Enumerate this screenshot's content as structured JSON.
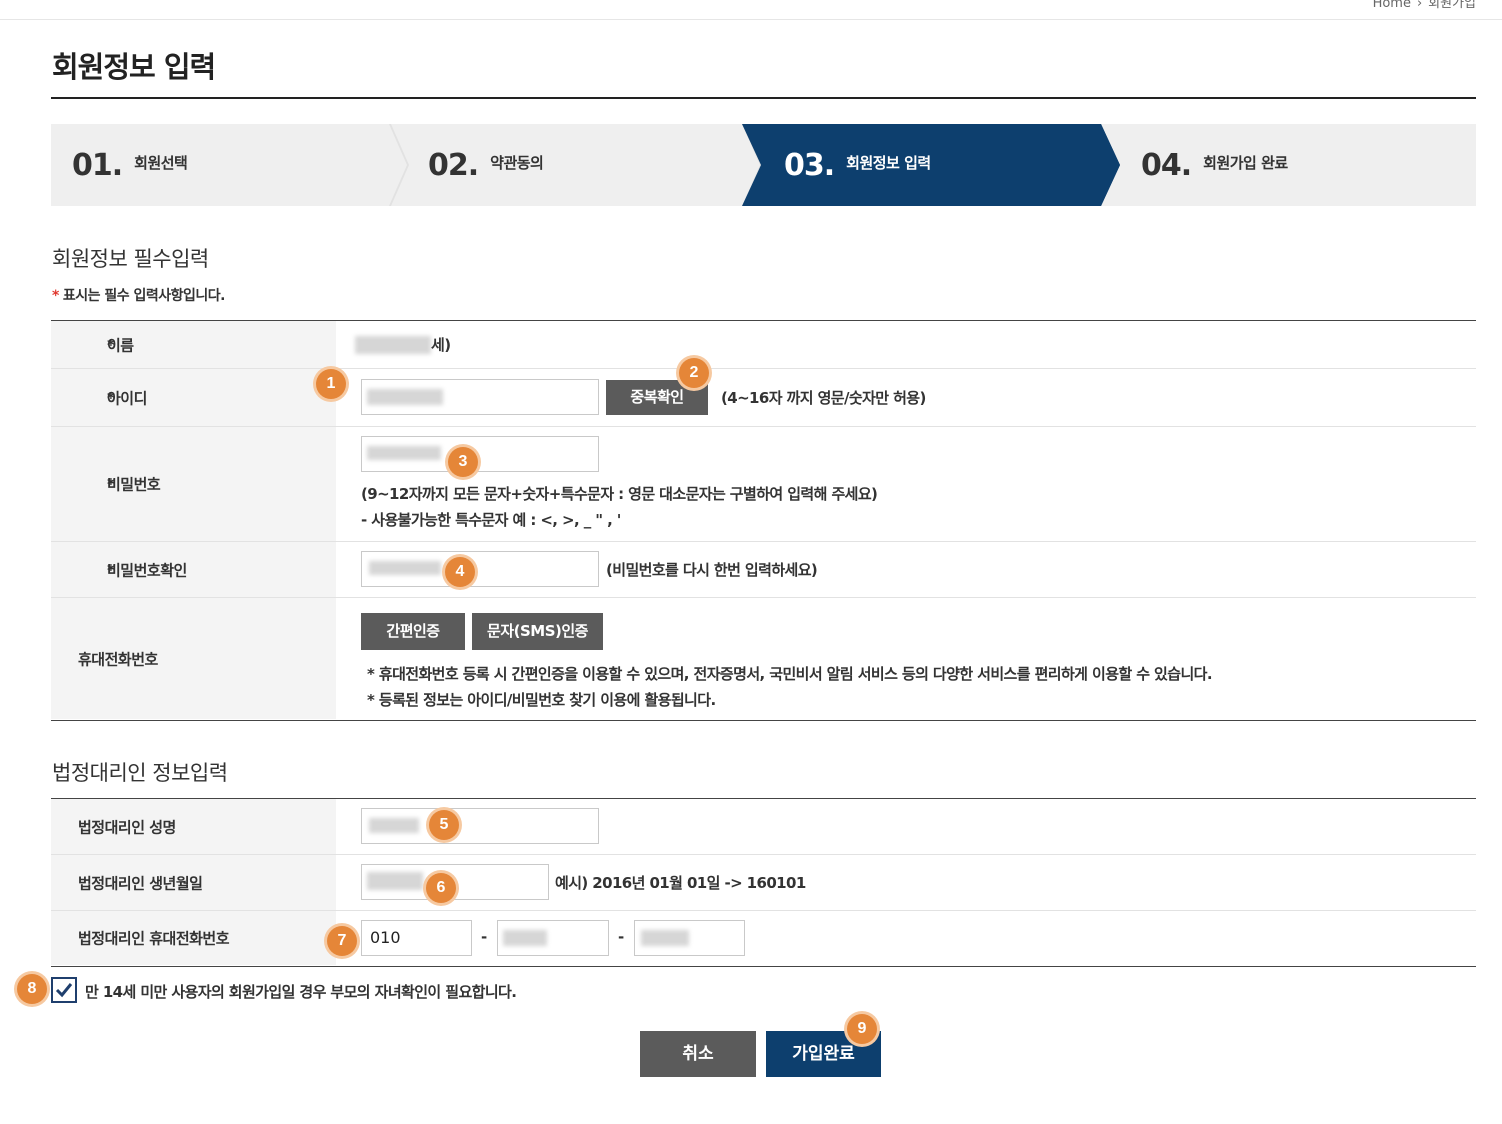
{
  "breadcrumb": {
    "home": "Home",
    "current": "회원가입"
  },
  "page_title": "회원정보 입력",
  "steps": [
    {
      "num": "01.",
      "label": "회원선택",
      "active": false
    },
    {
      "num": "02.",
      "label": "약관동의",
      "active": false
    },
    {
      "num": "03.",
      "label": "회원정보 입력",
      "active": true
    },
    {
      "num": "04.",
      "label": "회원가입 완료",
      "active": false
    }
  ],
  "colors": {
    "accent_navy": "#0d3f6e",
    "badge_orange": "#e58638",
    "required_red": "#e0382f",
    "button_gray": "#5b5b5b"
  },
  "required_section": {
    "title": "회원정보 필수입력",
    "required_note": "표시는 필수 입력사항입니다.",
    "required_mark": "*",
    "name": {
      "label": "이름",
      "value_suffix": "세)"
    },
    "id": {
      "label": "아이디",
      "check_button": "중복확인",
      "hint": "(4~16자 까지 영문/숫자만 허용)"
    },
    "password": {
      "label": "비밀번호",
      "hint1": "(9~12자까지 모든 문자+숫자+특수문자 : 영문 대소문자는 구별하여 입력해 주세요)",
      "hint2": "- 사용불가능한 특수문자 예 : <, >, _ \" , '"
    },
    "password_confirm": {
      "label": "비밀번호확인",
      "hint": "(비밀번호를 다시 한번 입력하세요)"
    },
    "phone": {
      "label": "휴대전화번호",
      "easy_auth_button": "간편인증",
      "sms_auth_button": "문자(SMS)인증",
      "note1": "* 휴대전화번호 등록 시 간편인증을 이용할 수 있으며, 전자증명서, 국민비서 알림 서비스 등의 다양한 서비스를 편리하게 이용할 수 있습니다.",
      "note2": "* 등록된 정보는 아이디/비밀번호 찾기 이용에 활용됩니다."
    }
  },
  "guardian_section": {
    "title": "법정대리인 정보입력",
    "name_label": "법정대리인 성명",
    "birth_label": "법정대리인 생년월일",
    "birth_hint": "예시) 2016년 01월 01일 -> 160101",
    "phone_label": "법정대리인 휴대전화번호",
    "phone_prefix": "010",
    "dash": "-"
  },
  "consent": {
    "checked": true,
    "label": "만 14세 미만 사용자의 회원가입일 경우 부모의 자녀확인이 필요합니다."
  },
  "actions": {
    "cancel": "취소",
    "submit": "가입완료"
  },
  "badges": [
    "1",
    "2",
    "3",
    "4",
    "5",
    "6",
    "7",
    "8",
    "9"
  ]
}
